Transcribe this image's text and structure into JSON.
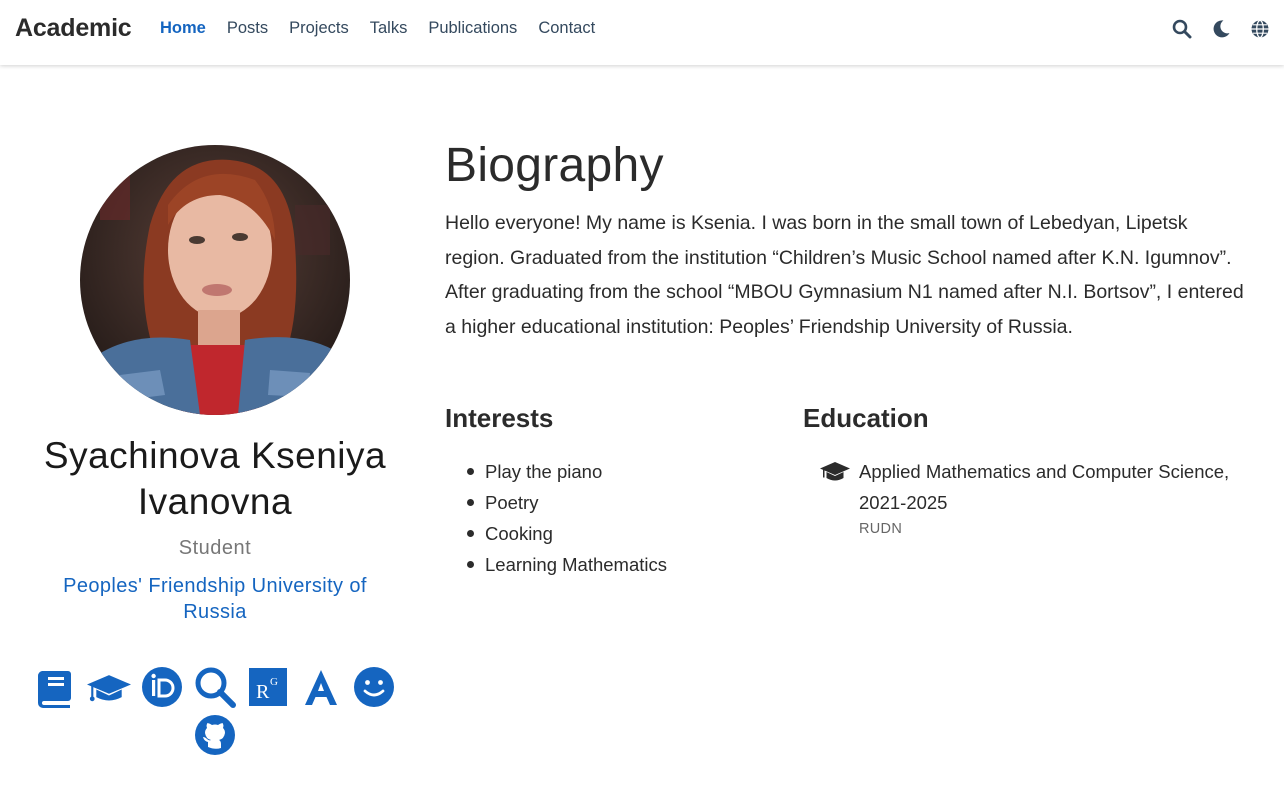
{
  "navbar": {
    "brand": "Academic",
    "links": [
      {
        "label": "Home",
        "active": true
      },
      {
        "label": "Posts"
      },
      {
        "label": "Projects"
      },
      {
        "label": "Talks"
      },
      {
        "label": "Publications"
      },
      {
        "label": "Contact"
      }
    ],
    "icons": [
      "search-icon",
      "moon-icon",
      "globe-icon"
    ]
  },
  "profile": {
    "name_line1": "Syachinova Kseniya",
    "name_line2": "Ivanovna",
    "role": "Student",
    "organization_line1": "Peoples' Friendship University of",
    "organization_line2": "Russia",
    "social_icons": [
      "book-icon",
      "graduation-cap-icon",
      "orcid-icon",
      "search-icon",
      "researchgate-icon",
      "academia-icon",
      "smile-icon",
      "github-icon"
    ]
  },
  "biography": {
    "title": "Biography",
    "text": "Hello everyone! My name is Ksenia. I was born in the small town of Lebedyan, Lipetsk region. Graduated from the institution “Children’s Music School named after K.N. Igumnov”. After graduating from the school “MBOU Gymnasium N1 named after N.I. Bortsov”, I entered a higher educational institution: Peoples’ Friendship University of Russia."
  },
  "interests": {
    "title": "Interests",
    "items": [
      "Play the piano",
      "Poetry",
      "Cooking",
      "Learning Mathematics"
    ]
  },
  "education": {
    "title": "Education",
    "items": [
      {
        "course_line1": "Applied Mathematics and Computer Science,",
        "course_line2": "2021-2025",
        "institution": "RUDN"
      }
    ]
  },
  "colors": {
    "accent": "#1565c0",
    "text": "#2b2b2b",
    "muted": "#777777"
  }
}
